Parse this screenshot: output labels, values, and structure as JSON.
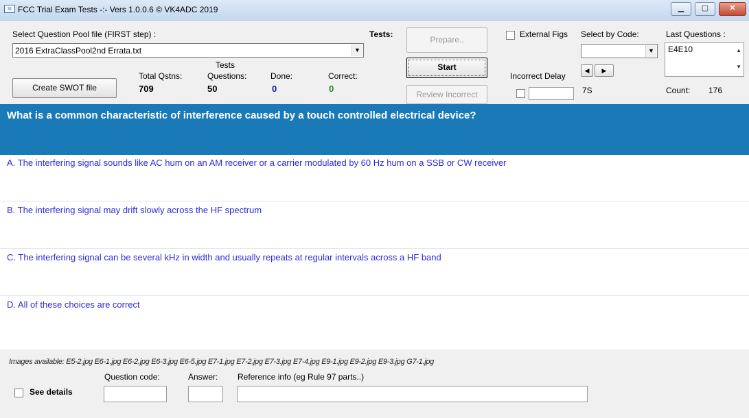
{
  "window": {
    "title": "FCC Trial Exam Tests -:-  Vers 1.0.0.6 © VK4ADC 2019",
    "icon_name": "app-icon",
    "minimize": "minimize-icon",
    "maximize": "maximize-icon",
    "close": "close-icon"
  },
  "pool": {
    "label": "Select Question Pool file (FIRST step) :",
    "selected": "2016 ExtraClassPool2nd Errata.txt"
  },
  "buttons": {
    "create_swot": "Create SWOT file",
    "prepare": "Prepare..",
    "start": "Start",
    "review_incorrect": "Review Incorrect"
  },
  "stats": {
    "tests_label": "Tests:",
    "total_label": "Total Qstns:",
    "total_value": "709",
    "tests_questions_label_1": "Tests",
    "tests_questions_label_2": "Questions:",
    "tests_questions_value": "50",
    "done_label": "Done:",
    "done_value": "0",
    "correct_label": "Correct:",
    "correct_value": "0"
  },
  "options": {
    "external_figs": "External Figs",
    "select_by_code_label": "Select by Code:",
    "select_by_code_value": "",
    "incorrect_delay_label": "Incorrect Delay",
    "delay_value": "7S"
  },
  "last_questions": {
    "label": "Last Questions :",
    "items": [
      "E4E10"
    ],
    "count_label": "Count:",
    "count_value": "176"
  },
  "question": {
    "text": "What is a common characteristic of interference caused by a touch controlled electrical device?",
    "answers": [
      "A. The interfering signal sounds like AC hum on an AM receiver or a carrier modulated by 60 Hz hum on a SSB or CW receiver",
      "B. The interfering signal may drift slowly across the HF spectrum",
      "C. The interfering signal can be several kHz in width and usually repeats at regular intervals across a HF band",
      "D. All of these choices are correct"
    ]
  },
  "footer": {
    "images_available": "Images available: E5-2.jpg E6-1.jpg E6-2.jpg E6-3.jpg E6-5.jpg E7-1.jpg E7-2.jpg E7-3.jpg E7-4.jpg E9-1.jpg E9-2.jpg E9-3.jpg G7-1.jpg",
    "see_details": "See details",
    "question_code_label": "Question code:",
    "answer_label": "Answer:",
    "reference_label": "Reference info (eg Rule 97 parts..)",
    "question_code_value": "",
    "answer_value": "",
    "reference_value": ""
  },
  "colors": {
    "question_band": "#1a7ab8",
    "answer_text": "#2a2adb",
    "done_value": "#1a1aa0",
    "correct_value": "#1e8a1e"
  }
}
